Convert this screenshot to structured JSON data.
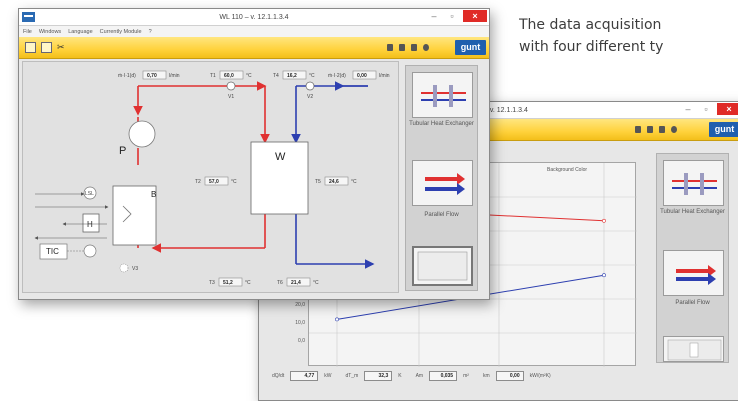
{
  "caption": {
    "line1": "The data acquisition",
    "line2": "with four different ty"
  },
  "window_main": {
    "title": "WL 110 – v. 12.1.1.3.4",
    "menu": [
      "File",
      "Windows",
      "Language",
      "Currently Module",
      "?"
    ],
    "logo": "gunt",
    "labels": {
      "pump": "P",
      "tank": "B",
      "heater": "H",
      "exchanger": "W",
      "tic": "TIC",
      "lsl": "LSL",
      "v1": "V1",
      "v2": "V2",
      "v3": "V3",
      "t1": "T1",
      "t2": "T2",
      "t3": "T3",
      "t4": "T4",
      "t5": "T5",
      "t6": "T6",
      "fi1": "ṁ·I·1(d)",
      "fi2": "ṁ·I·2(d)",
      "unit_c": "°C",
      "unit_flow": "l/min"
    },
    "values": {
      "flow_hot": "0,70",
      "flow_cold": "0,00",
      "t1": "60,0",
      "t2": "57,0",
      "t3": "51,2",
      "t4": "16,2",
      "t5": "24,6",
      "t6": "21,4"
    },
    "side_panel": {
      "item1": "Tubular Heat Exchanger",
      "item2": "Parallel Flow"
    }
  },
  "window_chart": {
    "title": "– v. 12.1.1.3.4",
    "logo": "gunt",
    "legend": "Background Color",
    "side_panel": {
      "item1": "Tubular Heat Exchanger",
      "item2": "Parallel Flow"
    },
    "axis_labels": [
      "20,0",
      "10,0",
      "0,0"
    ],
    "bottom": {
      "q_label": "dQ/dt",
      "q_value": "4,77",
      "q_unit": "kW",
      "dt_label": "dT_m",
      "dt_value": "32,3",
      "dt_unit": "K",
      "area_label": "Am",
      "area_value": "0,035",
      "area_unit": "m²",
      "k_label": "km",
      "k_value": "0,00",
      "k_unit": "kW/(m²K)"
    }
  },
  "colors": {
    "hot": "#e03131",
    "cold": "#2d3fb0",
    "toolbar": "#ffd23c",
    "logo": "#1f5fae",
    "close": "#e02b27"
  },
  "chart_data": {
    "type": "line",
    "title": "",
    "xlabel": "",
    "ylabel": "",
    "series": [
      {
        "values": [
          47,
          43
        ]
      },
      {
        "values": [
          14,
          27
        ]
      }
    ]
  }
}
